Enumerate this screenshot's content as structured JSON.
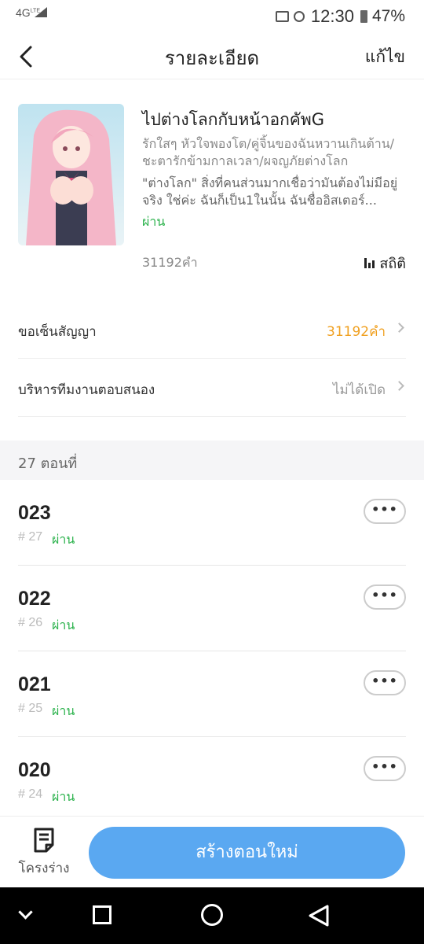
{
  "status_bar": {
    "network": "4G",
    "network_sup": "LTE",
    "time": "12:30",
    "battery": "47%"
  },
  "header": {
    "title": "รายละเอียด",
    "edit_label": "แก้ไข"
  },
  "book": {
    "title": "ไปต่างโลกกับหน้าอกคัพG",
    "tags": "รักใสๆ หัวใจพองโต/คู่จิ้นของฉันหวานเกินต้าน/ชะตารักข้ามกาลเวลา/ผจญภัยต่างโลก",
    "description": "\"ต่างโลก\" สิ่งที่คนส่วนมากเชื่อว่ามันต้องไม่มีอยู่จริง ใช่ค่ะ ฉันก็เป็น1ในนั้น ฉันชื่ออิสเตอร์...",
    "status": "ผ่าน",
    "word_count": "31192คำ",
    "stats_label": "สถิติ"
  },
  "settings": {
    "contract": {
      "label": "ขอเซ็นสัญญา",
      "value": "31192คำ",
      "color": "#f0a020"
    },
    "response_team": {
      "label": "บริหารทีมงานตอบสนอง",
      "value": "ไม่ได้เปิด",
      "color": "#999999"
    }
  },
  "chapters_section": {
    "title": "27 ตอนที่"
  },
  "chapters": [
    {
      "name": "023",
      "number": "# 27",
      "status": "ผ่าน",
      "more": "•••"
    },
    {
      "name": "022",
      "number": "# 26",
      "status": "ผ่าน",
      "more": "•••"
    },
    {
      "name": "021",
      "number": "# 25",
      "status": "ผ่าน",
      "more": "•••"
    },
    {
      "name": "020",
      "number": "# 24",
      "status": "ผ่าน",
      "more": "•••"
    }
  ],
  "bottom": {
    "outline_label": "โครงร่าง",
    "create_label": "สร้างตอนใหม่"
  },
  "colors": {
    "accent": "#5aa8f1",
    "passed": "#2bb24c"
  }
}
